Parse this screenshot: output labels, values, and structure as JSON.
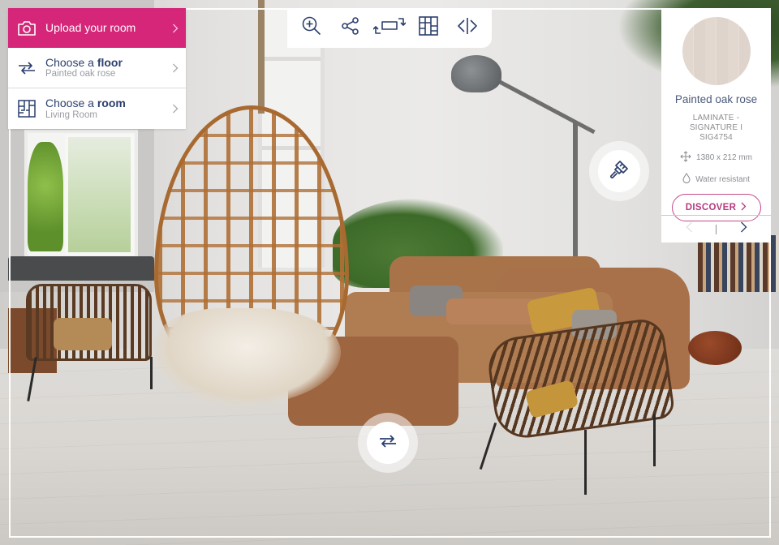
{
  "colors": {
    "brand_pink": "#d5267a",
    "navy": "#2b3f6e",
    "muted_text": "#9a9ca3",
    "discover_border": "#c24b88"
  },
  "menu": {
    "upload": {
      "label": "Upload your room",
      "icon": "camera-icon"
    },
    "floor": {
      "prefix": "Choose a ",
      "keyword": "floor",
      "value": "Painted oak rose",
      "icon": "swap-arrows-icon"
    },
    "room": {
      "prefix": "Choose a ",
      "keyword": "room",
      "value": "Living Room",
      "icon": "floorplan-icon"
    }
  },
  "toolbar": {
    "tools": [
      {
        "name": "zoom-in",
        "icon": "zoom-in-icon"
      },
      {
        "name": "share",
        "icon": "share-icon"
      },
      {
        "name": "rotate-floor",
        "icon": "rotate-plank-icon"
      },
      {
        "name": "laying-pattern",
        "icon": "pattern-grid-icon"
      },
      {
        "name": "compare",
        "icon": "compare-split-icon"
      }
    ]
  },
  "product": {
    "name": "Painted oak rose",
    "code_line1": "LAMINATE -",
    "code_line2": "SIGNATURE I",
    "code_line3": "SIG4754",
    "dimensions": "1380 x 212 mm",
    "feature": "Water resistant",
    "discover_label": "DISCOVER",
    "nav": {
      "prev_enabled": false,
      "next_enabled": true
    }
  },
  "floating_buttons": {
    "paint": {
      "icon": "paint-brush-icon"
    },
    "swap_floor": {
      "icon": "swap-arrows-icon"
    }
  }
}
